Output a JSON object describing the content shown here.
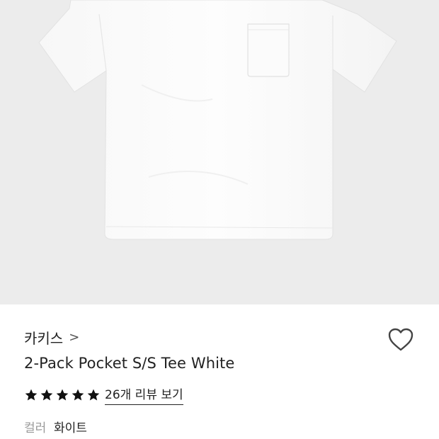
{
  "product_image": {
    "alt": "white pocket t-shirt"
  },
  "brand": {
    "name": "카키스",
    "chevron": ">"
  },
  "product": {
    "title": "2-Pack Pocket S/S Tee White"
  },
  "rating": {
    "stars": 5,
    "max_stars": 5,
    "review_link": "26개 리뷰 보기"
  },
  "color": {
    "label": "컬러",
    "value": "화이트"
  },
  "icons": {
    "wishlist": "heart-outline-icon",
    "star": "star-filled-icon"
  },
  "colors": {
    "image_bg": "#ececec",
    "text": "#222222",
    "muted": "#9a9a9a"
  }
}
